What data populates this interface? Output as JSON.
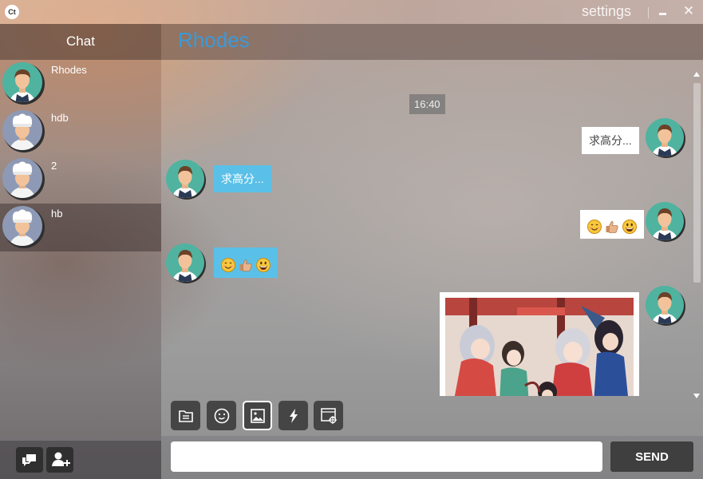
{
  "window": {
    "logo_text": "Ct",
    "settings_label": "settings",
    "minimize_icon": "minimize-icon",
    "close_icon": "close-icon"
  },
  "sidebar": {
    "title": "Chat",
    "contacts": [
      {
        "name": "Rhodes",
        "avatar": "male-avatar"
      },
      {
        "name": "hdb",
        "avatar": "chef-avatar"
      },
      {
        "name": "2",
        "avatar": "chef-avatar"
      },
      {
        "name": "hb",
        "avatar": "chef-avatar",
        "selected": true
      }
    ],
    "footer_buttons": [
      "chat-bubbles-icon",
      "add-user-icon"
    ]
  },
  "chat": {
    "contact_name": "Rhodes",
    "messages": [
      {
        "type": "time",
        "text": "16:40"
      },
      {
        "type": "text",
        "direction": "out",
        "text": "求高分..."
      },
      {
        "type": "text",
        "direction": "in",
        "text": "求高分..."
      },
      {
        "type": "emoji",
        "direction": "out",
        "emojis": [
          "smiling-face",
          "thumbs-up",
          "grinning-face"
        ]
      },
      {
        "type": "emoji",
        "direction": "in",
        "emojis": [
          "smiling-face",
          "thumbs-up",
          "grinning-face"
        ]
      },
      {
        "type": "image",
        "direction": "out",
        "description": "anime-illustration"
      }
    ]
  },
  "toolbar": {
    "buttons": [
      "file-icon",
      "emoji-icon",
      "image-icon",
      "shake-icon",
      "screenshot-icon"
    ],
    "selected": "image-icon"
  },
  "composer": {
    "input_value": "",
    "input_placeholder": "",
    "send_label": "SEND"
  },
  "colors": {
    "title_accent": "#3a9ad9",
    "incoming_bubble": "#5bc0e8",
    "outgoing_bubble": "#ffffff",
    "send_button": "#3f3f3f"
  }
}
